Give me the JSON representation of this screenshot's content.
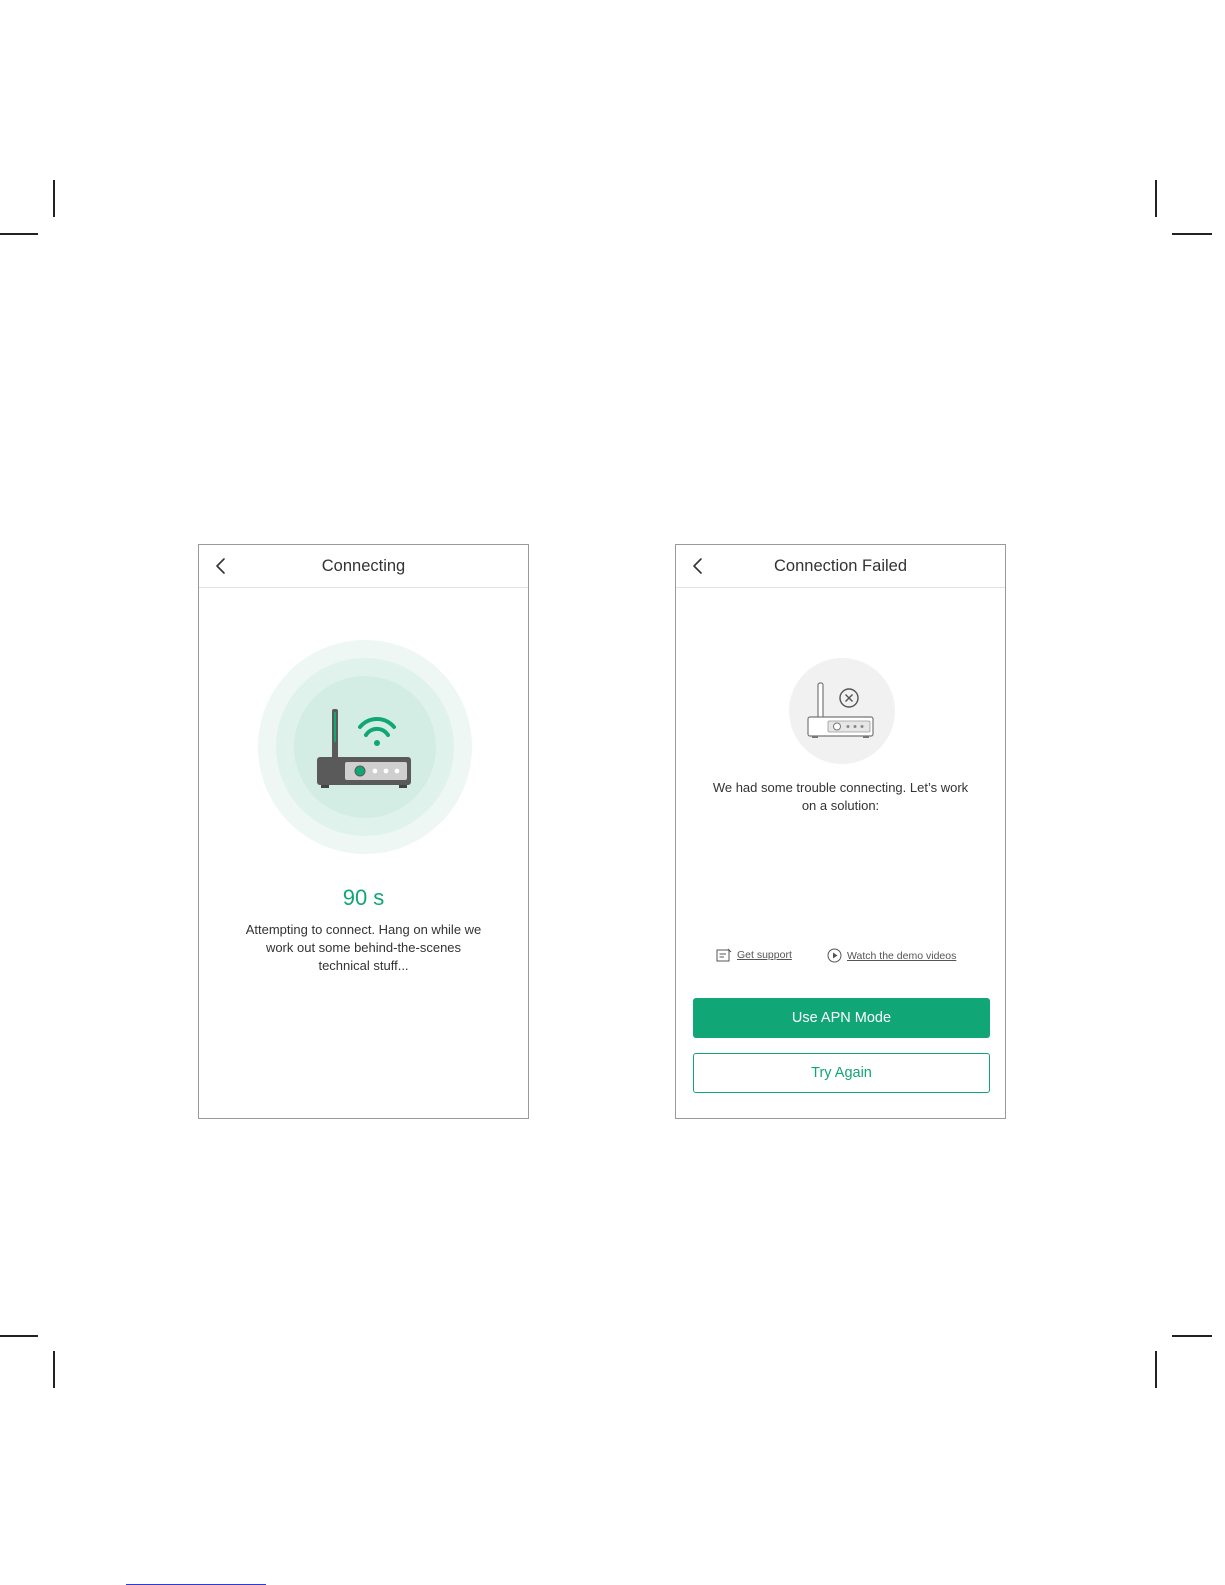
{
  "colors": {
    "accent": "#11a676",
    "text": "#333333",
    "border": "#9a9a9a"
  },
  "connecting_screen": {
    "title": "Connecting",
    "back_icon": "chevron-left-icon",
    "hero_icon": "router-wifi-icon",
    "countdown": "90 s",
    "description": "Attempting to connect. Hang on while we work out some behind-the-scenes technical stuff..."
  },
  "failed_screen": {
    "title": "Connection Failed",
    "back_icon": "chevron-left-icon",
    "hero_icon": "router-error-icon",
    "description": "We had some trouble connecting. Let’s work on a solution:",
    "links": {
      "support": {
        "label": "Get support",
        "icon": "support-doc-icon"
      },
      "videos": {
        "label": "Watch the demo videos",
        "icon": "play-circle-icon"
      }
    },
    "primary_button": "Use APN Mode",
    "secondary_button": "Try Again"
  }
}
